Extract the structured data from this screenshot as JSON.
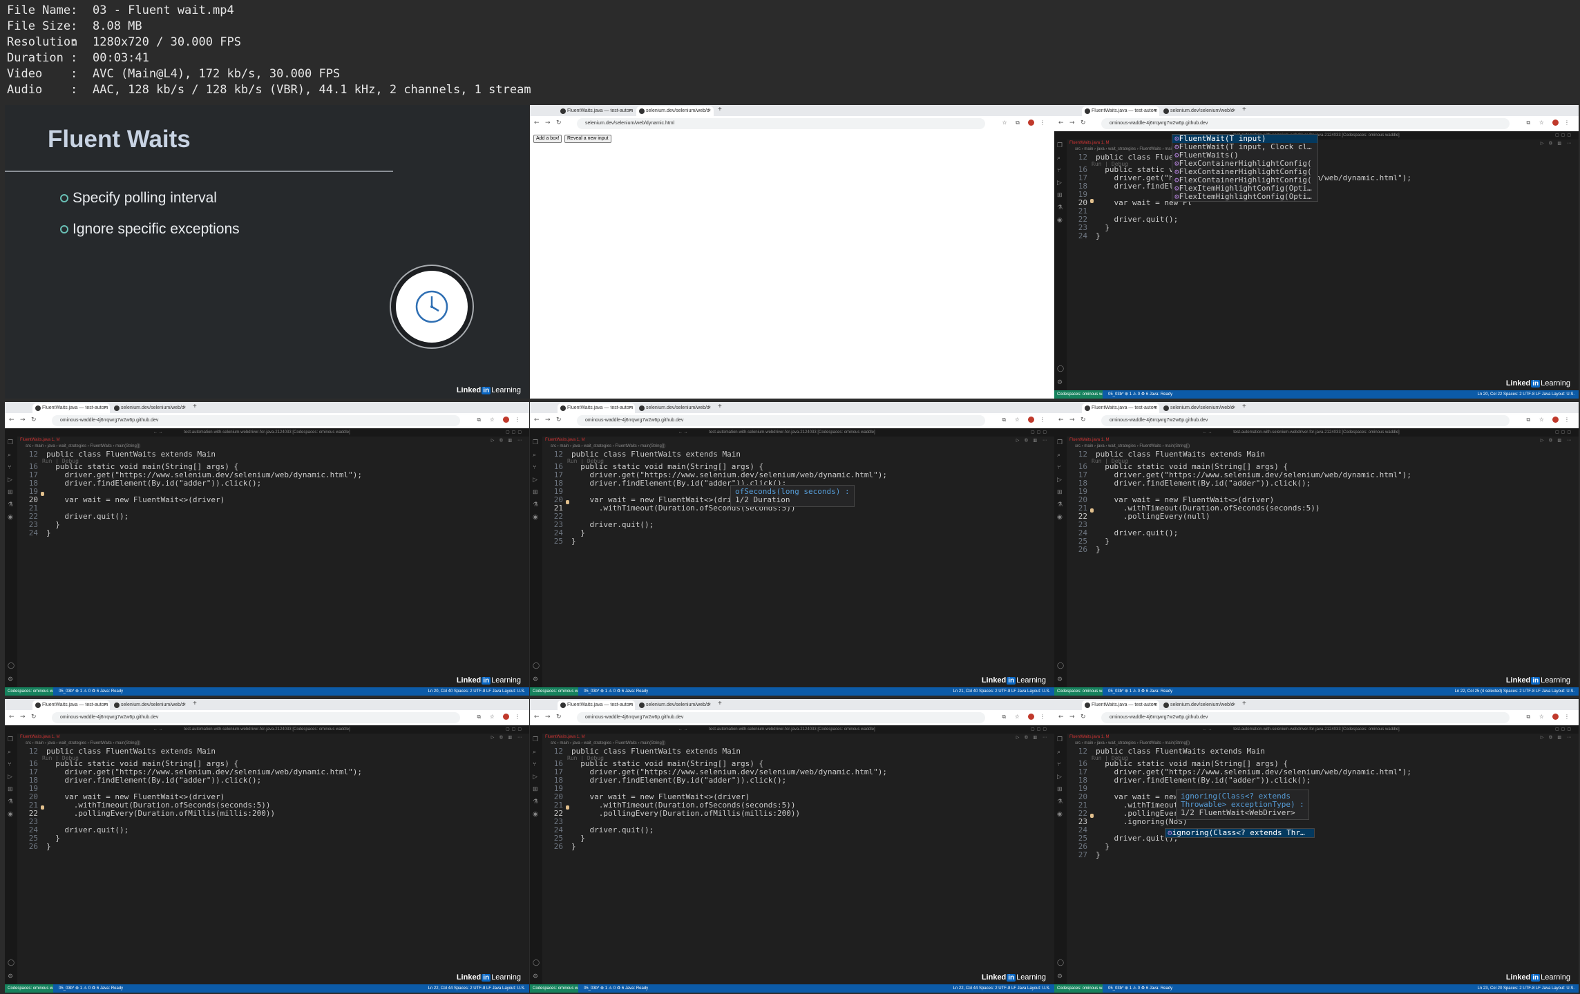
{
  "file_info": {
    "rows": [
      {
        "key": "File Name",
        "value": "03 - Fluent wait.mp4"
      },
      {
        "key": "File Size",
        "value": "8.08 MB"
      },
      {
        "key": "Resolution",
        "value": "1280x720 / 30.000 FPS"
      },
      {
        "key": "Duration",
        "value": "00:03:41"
      },
      {
        "key": "Video",
        "value": "AVC (Main@L4), 172 kb/s, 30.000 FPS"
      },
      {
        "key": "Audio",
        "value": "AAC, 128 kb/s / 128 kb/s (VBR), 44.1 kHz, 2 channels, 1 stream"
      }
    ],
    "separator": ":"
  },
  "watermark": {
    "linked": "Linked",
    "in": "in",
    "learning": "Learning"
  },
  "slide": {
    "title": "Fluent Waits",
    "bullets": [
      "Specify polling interval",
      "Ignore specific exceptions"
    ],
    "icon": "clock-icon"
  },
  "browser": {
    "tab_a": "FluentWaits.java — test-autom",
    "tab_b": "selenium.dev/selenium/web/d",
    "codespace_url": "ominous-waddle-4j6rrqwrg7w2w6p.github.dev",
    "dynamic_url": "selenium.dev/selenium/web/dynamic.html",
    "add_box_button": "Add a box!",
    "reveal_button": "Reveal a new input"
  },
  "vscode": {
    "title": "test-automation-with-selenium-webdriver-for-java-2124033 [Codespaces: ominous waddle]",
    "editor_tab": "FluentWaits.java 1, M",
    "breadcrumbs": "src › main › java › wait_strategies › FluentWaits › main(String[])",
    "run_debug": "Run | Debug",
    "status_remote": "Codespaces: ominous waddle",
    "status_left": "05_03b*   ⊗ 1 ⚠ 0   ♻ 6   Java: Ready",
    "status_right": [
      "Ln 20, Col 22   Spaces: 2   UTF-8   LF   Java   Layout: U.S.",
      "Ln 20, Col 40   Spaces: 2   UTF-8   LF   Java   Layout: U.S.",
      "Ln 21, Col 40   Spaces: 2   UTF-8   LF   Java   Layout: U.S.",
      "Ln 22, Col 25 (4 selected)   Spaces: 2   UTF-8   LF   Java   Layout: U.S.",
      "Ln 22, Col 44   Spaces: 2   UTF-8   LF   Java   Layout: U.S.",
      "Ln 22, Col 44   Spaces: 2   UTF-8   LF   Java   Layout: U.S.",
      "Ln 23, Col 20   Spaces: 2   UTF-8   LF   Java   Layout: U.S."
    ]
  },
  "code": {
    "class_line": "public class FluentWaits extends Main",
    "main_line": "  public static void main(String[] args) {",
    "get_line": "    driver.get(\"https://www.selenium.dev/selenium/web/dynamic.html\");",
    "find_line": "    driver.findElement(By.id(\"adder\")).click();",
    "quit_line": "    driver.quit();",
    "close_method": "  }",
    "close_class": "}",
    "wait_partial": "    var wait = new Fl",
    "wait_driver": "    var wait = new FluentWait<>(driver)",
    "wait_driver_a": "    var wait = new FluentWait<>(driver)",
    "timeout_partial": "      .withTimeout(Duration.ofSeconds(seconds:5))",
    "timeout_full": "      .withTimeout(Duration.ofSeconds(seconds:5))",
    "polling_null": "      .pollingEvery(null)",
    "polling_millis": "      .pollingEvery(Duration.ofMillis(millis:200))",
    "wait_new": "    var wait = new ",
    "timeout_cut": "      .withTimeout(",
    "polling_cut": "      .pollingEvery",
    "ignoring": "      .ignoring(NoS)"
  },
  "popups": {
    "suggest": [
      "FluentWait(T input)",
      "FluentWait(T input, Clock cl…",
      "FluentWaits()",
      "FlexContainerHighlightConfig(",
      "FlexContainerHighlightConfig(",
      "FlexContainerHighlightConfig(",
      "FlexItemHighlightConfig(Opti…",
      "FlexItemHighlightConfig(Opti…"
    ],
    "sig_of_seconds": "ofSeconds(long seconds) :",
    "sig_of_seconds_ret": "1/2 Duration",
    "sig_ignoring_1": "ignoring(Class<? extends",
    "sig_ignoring_2": "Throwable> exceptionType) :",
    "sig_ignoring_3": "1/2 FluentWait<WebDriver>",
    "sig_ignoring_item": "ignoring(Class<? extends Thr…"
  },
  "colors": {
    "accent": "#0a66c2",
    "status_bar": "#0c5ba8",
    "remote": "#16825d",
    "editor_bg": "#1f1f1f"
  }
}
